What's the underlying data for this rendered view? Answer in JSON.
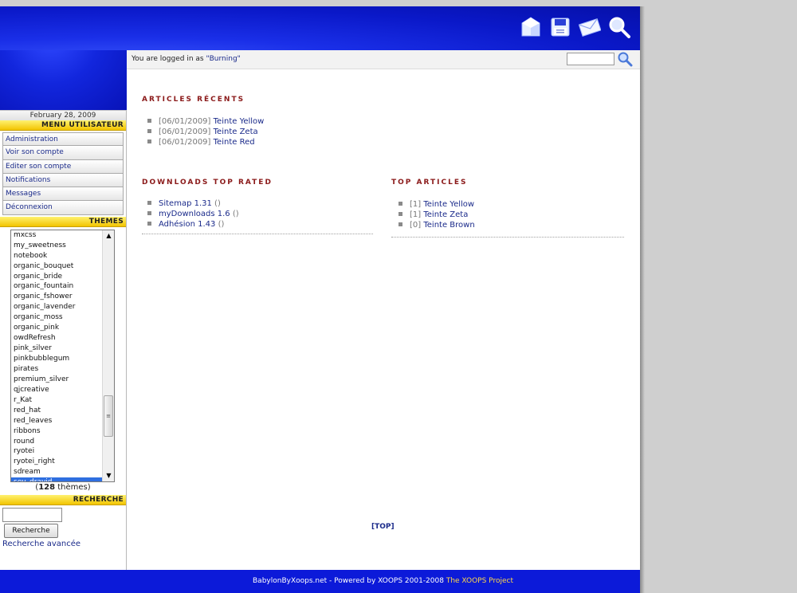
{
  "header": {
    "icons": [
      "home-icon",
      "save-icon",
      "mail-icon",
      "search-icon"
    ]
  },
  "loggedbar": {
    "prefix": "You are logged in as ",
    "username": "\"Burning\""
  },
  "sidebar": {
    "date": "February 28, 2009",
    "user_menu_title": "MENU UTILISATEUR",
    "menu": [
      "Administration",
      "Voir son compte",
      "Editer son compte",
      "Notifications",
      "Messages",
      "Déconnexion"
    ],
    "themes_title": "THEMES",
    "themes": [
      "mxcss",
      "my_sweetness",
      "notebook",
      "organic_bouquet",
      "organic_bride",
      "organic_fountain",
      "organic_fshower",
      "organic_lavender",
      "organic_moss",
      "organic_pink",
      "owdRefresh",
      "pink_silver",
      "pinkbubblegum",
      "pirates",
      "premium_silver",
      "qjcreative",
      "r_Kat",
      "red_hat",
      "red_leaves",
      "ribbons",
      "round",
      "ryotei",
      "ryotei_right",
      "sdream",
      "sev_dravid"
    ],
    "selected_theme": "sev_dravid",
    "theme_count_open": "(",
    "theme_count": "128",
    "theme_count_suffix": " thèmes)",
    "search_title": "RECHERCHE",
    "search_value": "",
    "search_button": "Recherche",
    "advanced_search": "Recherche avancée"
  },
  "main": {
    "recent_title": "ARTICLES RÉCENTS",
    "recent": [
      {
        "date": "[06/01/2009]",
        "title": "Teinte Yellow"
      },
      {
        "date": "[06/01/2009]",
        "title": "Teinte Zeta"
      },
      {
        "date": "[06/01/2009]",
        "title": "Teinte Red"
      }
    ],
    "downloads_title": "DOWNLOADS TOP RATED",
    "downloads": [
      {
        "name": "Sitemap 1.31",
        "extra": " ()"
      },
      {
        "name": "myDownloads 1.6",
        "extra": " ()"
      },
      {
        "name": "Adhésion 1.43",
        "extra": " ()"
      }
    ],
    "top_title": "TOP ARTICLES",
    "top": [
      {
        "rank": "[1]",
        "title": "Teinte Yellow"
      },
      {
        "rank": "[1]",
        "title": "Teinte Zeta"
      },
      {
        "rank": "[0]",
        "title": "Teinte Brown"
      }
    ],
    "top_link": "[TOP]"
  },
  "footer": {
    "text": "BabylonByXoops.net - Powered by XOOPS 2001-2008 ",
    "project": "The XOOPS Project"
  },
  "colors": {
    "header_blue": "#0c1ad9",
    "title_red": "#8b1a1a",
    "link_blue": "#1a2a8a",
    "bar_yellow": "#f2c400"
  }
}
